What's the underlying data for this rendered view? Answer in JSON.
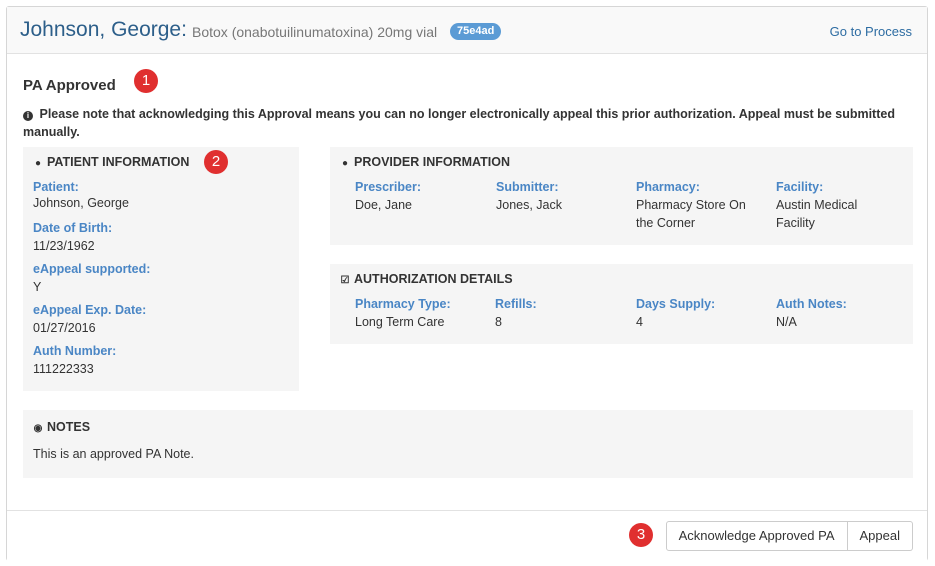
{
  "header": {
    "patient_name": "Johnson, George:",
    "drug": "Botox (onabotuilinumatoxina) 20mg vial",
    "id_badge": "75e4ad",
    "go_link": "Go to Process"
  },
  "status": {
    "title": "PA Approved",
    "notice": "Please note that acknowledging this Approval means you can no longer electronically appeal this prior authorization. Appeal must be submitted manually."
  },
  "callouts": [
    "1",
    "2",
    "3"
  ],
  "patient_info": {
    "title": "PATIENT INFORMATION",
    "fields": [
      {
        "label": "Patient:",
        "value": "Johnson, George"
      },
      {
        "label": "Date of Birth:",
        "value": "11/23/1962"
      },
      {
        "label": "eAppeal supported:",
        "value": "Y"
      },
      {
        "label": "eAppeal Exp. Date:",
        "value": "01/27/2016"
      },
      {
        "label": "Auth Number:",
        "value": "111222333"
      }
    ]
  },
  "provider_info": {
    "title": "PROVIDER INFORMATION",
    "fields": [
      {
        "label": "Prescriber:",
        "value": "Doe, Jane"
      },
      {
        "label": "Submitter:",
        "value": "Jones, Jack"
      },
      {
        "label": "Pharmacy:",
        "value": "Pharmacy Store On the Corner"
      },
      {
        "label": "Facility:",
        "value": "Austin Medical Facility"
      }
    ]
  },
  "auth_details": {
    "title": "AUTHORIZATION DETAILS",
    "fields": [
      {
        "label": "Pharmacy Type:",
        "value": "Long Term Care"
      },
      {
        "label": "Refills:",
        "value": "8"
      },
      {
        "label": "Days Supply:",
        "value": "4"
      },
      {
        "label": "Auth Notes:",
        "value": "N/A"
      }
    ]
  },
  "notes": {
    "title": "NOTES",
    "text": "This is an approved PA Note."
  },
  "footer": {
    "acknowledge_label": "Acknowledge Approved PA",
    "appeal_label": "Appeal"
  },
  "icons": {
    "info": "info-circle-icon",
    "patient": "user-icon",
    "provider": "user-md-icon",
    "auth": "check-square-icon",
    "notes": "comment-icon"
  },
  "colors": {
    "name": "#2d5f8a",
    "label": "#4a86c5",
    "badge": "#5b9bd5",
    "callout": "#e02f2f"
  }
}
